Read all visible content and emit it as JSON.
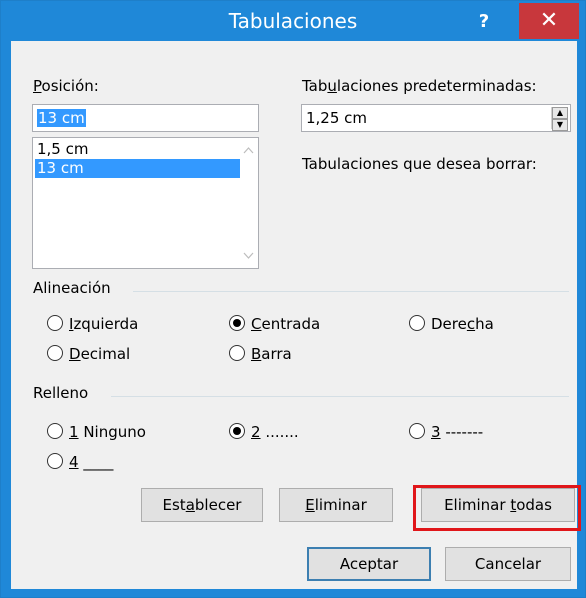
{
  "window": {
    "title": "Tabulaciones",
    "help_glyph": "?",
    "close_glyph": "✕"
  },
  "position": {
    "label_u": "P",
    "label_rest": "osición:",
    "value": "13 cm",
    "list": [
      "1,5 cm",
      "13 cm"
    ]
  },
  "default_tabs": {
    "label_pre": "Tab",
    "label_u": "u",
    "label_post": "laciones predeterminadas:",
    "value": "1,25 cm"
  },
  "clear_label": "Tabulaciones que desea borrar:",
  "alignment": {
    "group_label": "Alineación",
    "left": {
      "u": "I",
      "rest": "zquierda"
    },
    "center": {
      "u": "C",
      "rest": "entrada"
    },
    "right": {
      "pre": "Dere",
      "u": "c",
      "post": "ha"
    },
    "decimal": {
      "u": "D",
      "rest": "ecimal"
    },
    "bar": {
      "u": "B",
      "rest": "arra"
    },
    "selected": "Centrada"
  },
  "leader": {
    "group_label": "Relleno",
    "opt1": {
      "u": "1",
      "rest": " Ninguno"
    },
    "opt2": {
      "u": "2",
      "rest": " ......."
    },
    "opt3": {
      "u": "3",
      "rest": " -------"
    },
    "opt4": {
      "u": "4",
      "rest": " ____"
    },
    "selected": "2"
  },
  "buttons": {
    "set": {
      "pre": "Est",
      "u": "a",
      "post": "blecer"
    },
    "clear": {
      "u": "E",
      "rest": "liminar"
    },
    "clear_all": {
      "pre": "Eliminar ",
      "u": "t",
      "post": "odas"
    },
    "ok": "Aceptar",
    "cancel": "Cancelar"
  },
  "colors": {
    "titlebar": "#1f88d8",
    "close": "#c8373c",
    "selection": "#3399ff",
    "highlight_box": "#e0161a"
  }
}
